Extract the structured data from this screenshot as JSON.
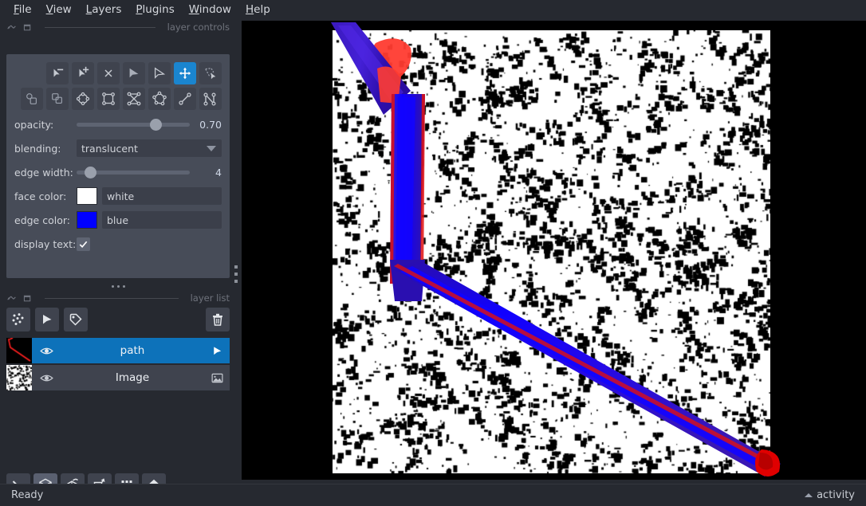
{
  "menu": {
    "items": [
      {
        "label": "File",
        "accel": "F"
      },
      {
        "label": "View",
        "accel": "V"
      },
      {
        "label": "Layers",
        "accel": "L"
      },
      {
        "label": "Plugins",
        "accel": "P"
      },
      {
        "label": "Window",
        "accel": "W"
      },
      {
        "label": "Help",
        "accel": "H"
      }
    ]
  },
  "layer_controls": {
    "title": "layer controls",
    "tools_row1": [
      {
        "name": "select-vertex-remove",
        "active": false
      },
      {
        "name": "select-vertex-add",
        "active": false
      },
      {
        "name": "delete-shape",
        "active": false
      },
      {
        "name": "direct-select",
        "active": false
      },
      {
        "name": "select-shapes",
        "active": false
      },
      {
        "name": "pan-zoom",
        "active": true
      },
      {
        "name": "transform",
        "active": false
      }
    ],
    "tools_row2": [
      {
        "name": "move-to-front",
        "active": false
      },
      {
        "name": "move-to-back",
        "active": false
      },
      {
        "name": "add-ellipse",
        "active": false
      },
      {
        "name": "add-rectangle",
        "active": false
      },
      {
        "name": "add-polygon-lasso",
        "active": false
      },
      {
        "name": "add-polygon",
        "active": false
      },
      {
        "name": "add-line",
        "active": false
      },
      {
        "name": "add-path",
        "active": false
      }
    ],
    "opacity": {
      "label": "opacity:",
      "value": "0.70",
      "percent": 70
    },
    "blending": {
      "label": "blending:",
      "value": "translucent"
    },
    "edge_width": {
      "label": "edge width:",
      "value": "4",
      "percent": 12
    },
    "face_color": {
      "label": "face color:",
      "value": "white",
      "hex": "#ffffff"
    },
    "edge_color": {
      "label": "edge color:",
      "value": "blue",
      "hex": "#0000ff"
    },
    "display_text": {
      "label": "display text:",
      "checked": true
    }
  },
  "layer_list": {
    "title": "layer list",
    "buttons": [
      {
        "name": "new-points-layer"
      },
      {
        "name": "new-shapes-layer"
      },
      {
        "name": "new-labels-layer"
      }
    ],
    "delete_button": {
      "name": "delete-layer"
    },
    "layers": [
      {
        "name": "path",
        "selected": true,
        "visible": true,
        "type": "shapes"
      },
      {
        "name": "Image",
        "selected": false,
        "visible": true,
        "type": "image"
      }
    ]
  },
  "viewer_buttons": [
    {
      "name": "console",
      "active": false
    },
    {
      "name": "ndisplay-toggle",
      "active": true
    },
    {
      "name": "roll-dimensions",
      "active": false
    },
    {
      "name": "transpose-dimensions",
      "active": false
    },
    {
      "name": "grid-view",
      "active": false
    },
    {
      "name": "home-reset-view",
      "active": false
    }
  ],
  "statusbar": {
    "status": "Ready",
    "activity_label": "activity"
  },
  "canvas": {
    "background_hex": "#000000",
    "image_background_hex": "#ffffff",
    "path_edge_hex": "#0000ff",
    "path_highlight_hex": "#ff2020",
    "path_shadow_hex": "#3b1ac0"
  }
}
